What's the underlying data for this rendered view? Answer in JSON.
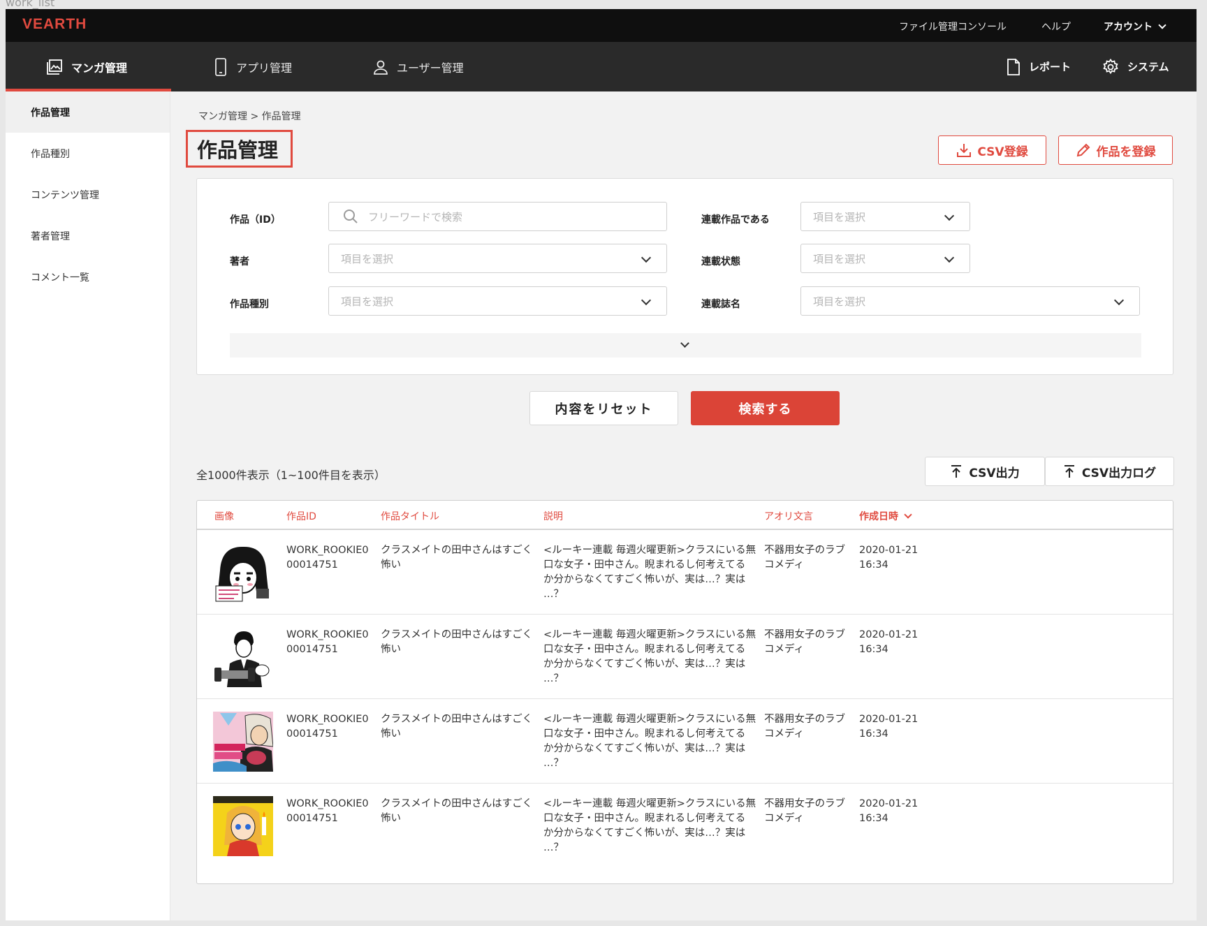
{
  "frame_label": "work_list",
  "brand": {
    "logo": "VEARTH",
    "accent": "#e04a3f"
  },
  "topbar": {
    "file_console": "ファイル管理コンソール",
    "help": "ヘルプ",
    "account": "アカウント"
  },
  "mainnav": {
    "items": [
      {
        "label": "マンガ管理",
        "icon": "image-icon"
      },
      {
        "label": "アプリ管理",
        "icon": "phone-icon"
      },
      {
        "label": "ユーザー管理",
        "icon": "user-icon"
      }
    ],
    "report": "レポート",
    "system": "システム"
  },
  "sidebar": {
    "items": [
      {
        "label": "作品管理"
      },
      {
        "label": "作品種別"
      },
      {
        "label": "コンテンツ管理"
      },
      {
        "label": "著者管理"
      },
      {
        "label": "コメント一覧"
      }
    ]
  },
  "breadcrumb": "マンガ管理 > 作品管理",
  "page_title": "作品管理",
  "actions": {
    "csv_register": "CSV登録",
    "register_work": "作品を登録"
  },
  "filters": {
    "work_id_label": "作品（ID）",
    "work_id_placeholder": "フリーワードで検索",
    "author_label": "著者",
    "type_label": "作品種別",
    "serialized_label": "連載作品である",
    "status_label": "連載状態",
    "magazine_label": "連載誌名",
    "select_placeholder": "項目を選択"
  },
  "buttons": {
    "reset": "内容をリセット",
    "search": "検索する",
    "csv_export": "CSV出力",
    "csv_export_log": "CSV出力ログ"
  },
  "results": {
    "count_text": "全1000件表示（1~100件目を表示）"
  },
  "table": {
    "headers": {
      "image": "画像",
      "id": "作品ID",
      "title": "作品タイトル",
      "description": "説明",
      "catch": "アオリ文言",
      "created": "作成日時"
    },
    "rows": [
      {
        "thumb": "thumbnail-1",
        "id": [
          "WORK_ROOKIE0",
          "00014751"
        ],
        "title": [
          "クラスメイトの田中さんはすごく",
          "怖い"
        ],
        "description": [
          "<ルーキー連載 毎週火曜更新>クラスにいる無",
          "口な女子・田中さん。睨まれるし何考えてる",
          "か分からなくてすごく怖いが、実は…？実は",
          "…？"
        ],
        "catch": [
          "不器用女子のラブ",
          "コメディ"
        ],
        "created": [
          "2020-01-21",
          "16:34"
        ]
      },
      {
        "thumb": "thumbnail-2",
        "id": [
          "WORK_ROOKIE0",
          "00014751"
        ],
        "title": [
          "クラスメイトの田中さんはすごく",
          "怖い"
        ],
        "description": [
          "<ルーキー連載 毎週火曜更新>クラスにいる無",
          "口な女子・田中さん。睨まれるし何考えてる",
          "か分からなくてすごく怖いが、実は…？実は",
          "…？"
        ],
        "catch": [
          "不器用女子のラブ",
          "コメディ"
        ],
        "created": [
          "2020-01-21",
          "16:34"
        ]
      },
      {
        "thumb": "thumbnail-3",
        "id": [
          "WORK_ROOKIE0",
          "00014751"
        ],
        "title": [
          "クラスメイトの田中さんはすごく",
          "怖い"
        ],
        "description": [
          "<ルーキー連載 毎週火曜更新>クラスにいる無",
          "口な女子・田中さん。睨まれるし何考えてる",
          "か分からなくてすごく怖いが、実は…？実は",
          "…？"
        ],
        "catch": [
          "不器用女子のラブ",
          "コメディ"
        ],
        "created": [
          "2020-01-21",
          "16:34"
        ]
      },
      {
        "thumb": "thumbnail-4",
        "id": [
          "WORK_ROOKIE0",
          "00014751"
        ],
        "title": [
          "クラスメイトの田中さんはすごく",
          "怖い"
        ],
        "description": [
          "<ルーキー連載 毎週火曜更新>クラスにいる無",
          "口な女子・田中さん。睨まれるし何考えてる",
          "か分からなくてすごく怖いが、実は…？実は",
          "…？"
        ],
        "catch": [
          "不器用女子のラブ",
          "コメディ"
        ],
        "created": [
          "2020-01-21",
          "16:34"
        ]
      }
    ]
  }
}
